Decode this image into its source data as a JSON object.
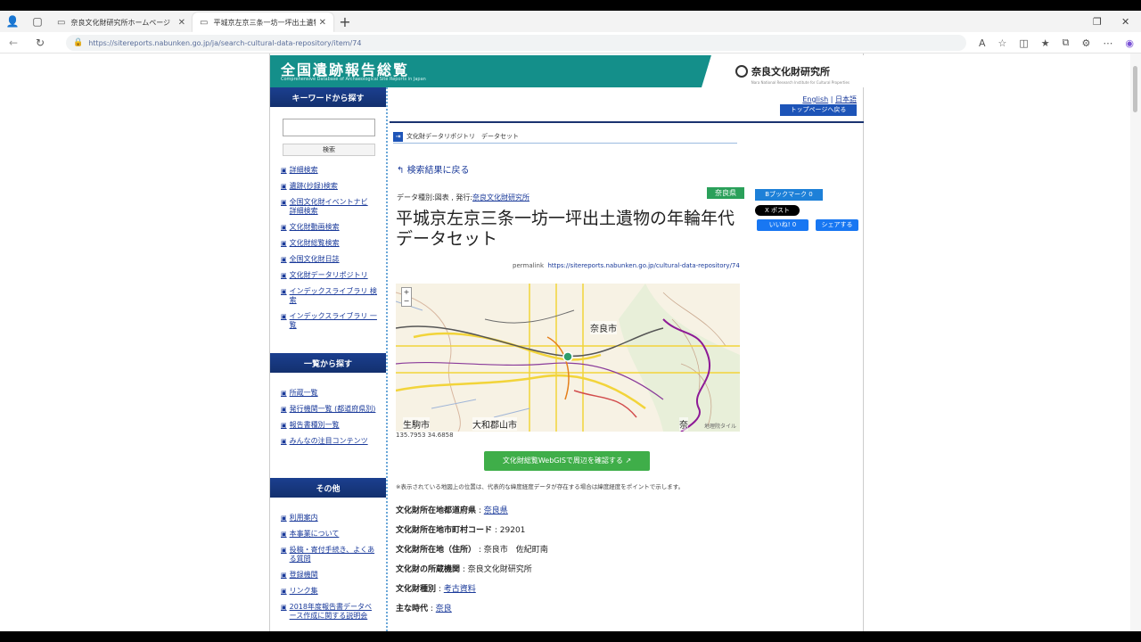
{
  "browser": {
    "tabs": [
      {
        "title": "奈良文化財研究所ホームページ",
        "active": false
      },
      {
        "title": "平城京左京三条一坊一坪出土遺物",
        "active": true
      }
    ],
    "url": "https://sitereports.nabunken.go.jp/ja/search-cultural-data-repository/item/74"
  },
  "site": {
    "title": "全国遺跡報告総覧",
    "subtitle": "Comprehensive Database of Archaeological Site Reports in Japan",
    "logo_text": "奈良文化財研究所",
    "logo_sub": "Nara National Research Institute for Cultural Properties"
  },
  "sidebar": {
    "keyword_head": "キーワードから探す",
    "search_button": "検索",
    "search_links": [
      "詳細検索",
      "遺跡(抄録)検索",
      "全国文化財イベントナビ 詳細検索",
      "文化財動画検索",
      "文化財総覧検索",
      "全国文化財日誌",
      "文化財データリポジトリ",
      "インデックスライブラリ 検索",
      "インデックスライブラリ 一覧"
    ],
    "list_head": "一覧から探す",
    "list_links": [
      "所蔵一覧",
      "発行機関一覧 (都道府県別)",
      "報告書種別一覧",
      "みんなの注目コンテンツ"
    ],
    "other_head": "その他",
    "other_links": [
      "利用案内",
      "本事業について",
      "投稿・寄付手続き、よくある質問",
      "登録機関",
      "リンク集",
      "2018年度報告書データベース作成に関する説明会"
    ]
  },
  "main": {
    "lang_english": "English",
    "lang_japanese": "日本語",
    "toppage_button": "トップページへ戻る",
    "breadcrumb": "文化財データリポジトリ　データセット",
    "back_link": "検索結果に戻る",
    "datatype_prefix": "データ種別:図表 , 発行:",
    "datatype_org": "奈良文化財研究所",
    "pref_badge": "奈良県",
    "bookmark_button": "Bブックマーク 0",
    "x_post": "X ポスト",
    "like_button": "いいね! 0",
    "share_button": "シェアする",
    "title": "平城京左京三条一坊一坪出土遺物の年輪年代データセット",
    "permalink_label": "permalink",
    "permalink_url": "https://sitereports.nabunken.go.jp/cultural-data-repository/74",
    "map": {
      "labels": [
        "奈良市",
        "生駒市",
        "大和郡山市",
        "奈"
      ],
      "attribution": "地理院タイル",
      "coords": "135.7953 34.6858"
    },
    "webgis_button": "文化財総覧WebGISで周辺を確認する",
    "note": "※表示されている地図上の位置は、代表的な緯度経度データが存在する場合は緯度経度をポイントで示します。",
    "fields": [
      {
        "label": "文化財所在地都道府県",
        "value": "奈良県",
        "link": true
      },
      {
        "label": "文化財所在地市町村コード",
        "value": "29201",
        "link": false
      },
      {
        "label": "文化財所在地（住所）",
        "value": "奈良市　佐紀町南",
        "link": false
      },
      {
        "label": "文化財の所蔵機関",
        "value": "奈良文化財研究所",
        "link": false
      },
      {
        "label": "文化財種別",
        "value": "考古資料",
        "link": true
      },
      {
        "label": "主な時代",
        "value": "奈良",
        "link": true
      }
    ]
  },
  "colors": {
    "header_teal": "#148f8a",
    "sidebar_head": "#1b3f8f",
    "link_blue": "#1a3a9a",
    "green_button": "#3fae49"
  }
}
